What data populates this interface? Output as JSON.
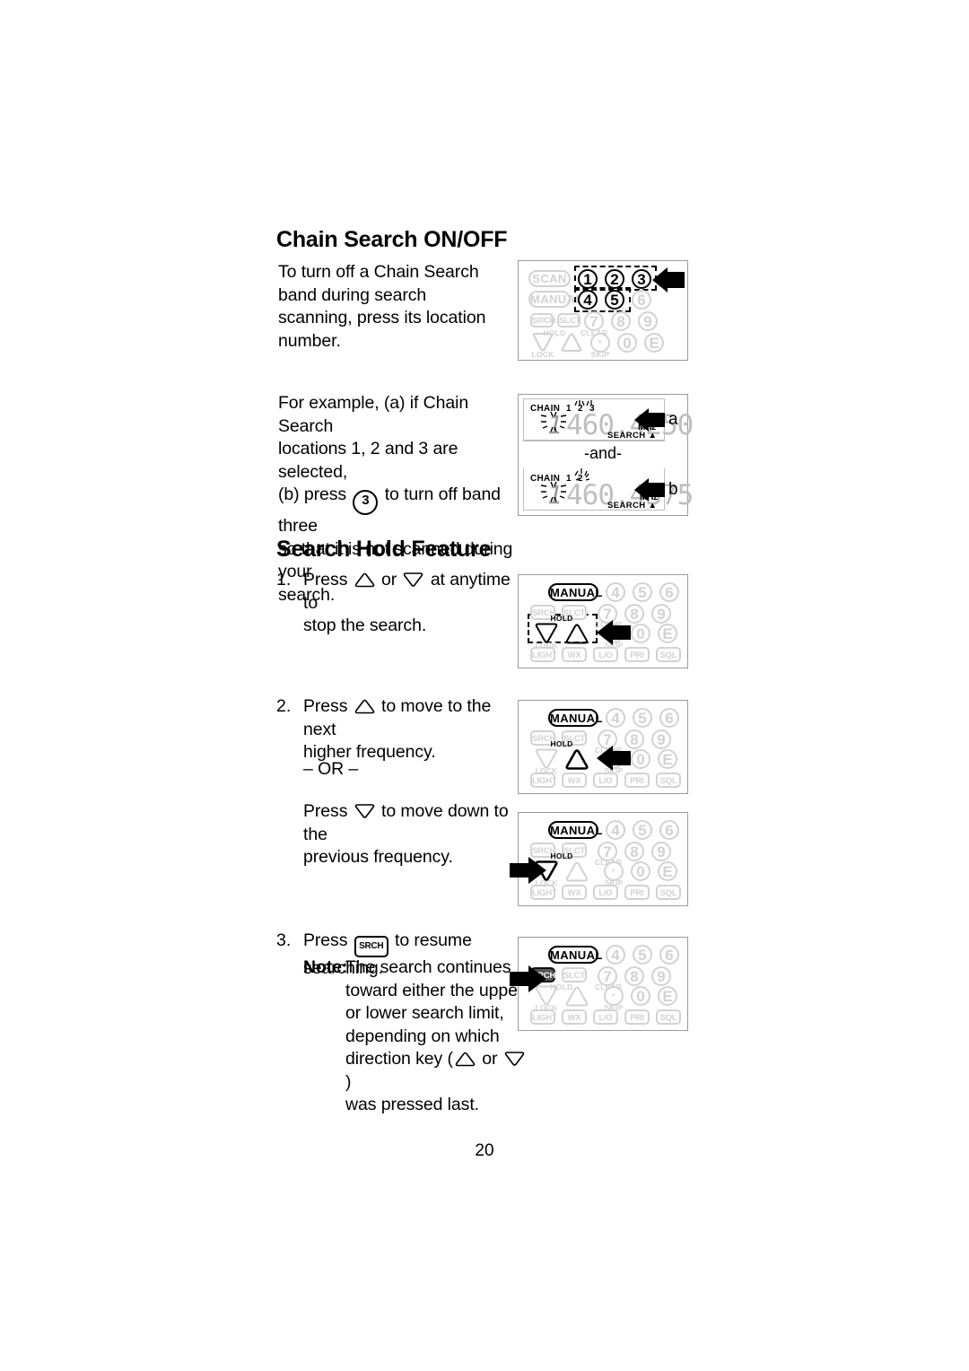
{
  "document": {
    "page_number": "20"
  },
  "sections": [
    {
      "heading": "Chain Search ON/OFF",
      "paragraph": "To turn off a Chain Search band during search scanning, press its location number."
    },
    {
      "heading": "Search Hold Feature"
    }
  ],
  "example": {
    "line1": "For example, (a) if Chain Search",
    "line2": "locations 1, 2 and 3 are selected,",
    "line3_pre": "(b) press",
    "line3_key": "3",
    "line3_post": "to turn off band three",
    "line4": "so that it is not scanned during your",
    "line5": "search."
  },
  "steps": [
    {
      "number": "1.",
      "pre": "Press",
      "mid": "or",
      "post": "at anytime to",
      "line2": "stop the search."
    },
    {
      "number": "2.",
      "pre": "Press",
      "post": "to move to the next",
      "line2": "higher frequency.",
      "or_divider": "– OR –",
      "alt_pre": "Press",
      "alt_post": "to move down to the",
      "alt_line2": "previous frequency."
    },
    {
      "number": "3.",
      "pre": "Press",
      "key": "SRCH",
      "post": "to resume searching.",
      "note_label": "Note:",
      "note_line1": "The search continues",
      "note_line2": "toward either the upper",
      "note_line3": "or lower search limit,",
      "note_line4": "depending on which",
      "note_line5_pre": "direction key (",
      "note_line5_mid": "or",
      "note_line5_post": ")",
      "note_line6": "was pressed last."
    }
  ],
  "keypad_labels": {
    "scan": "SCAN",
    "manual": "MANUAL",
    "srch": "SRCH",
    "slct": "SLCT",
    "hold": "HOLD",
    "clear": "CLEAR",
    "lock": "LOCK",
    "skip": "SKIP",
    "light": "LIGHT",
    "wx": "WX",
    "lo": "L/O",
    "pri": "PRI",
    "sql": "SQL",
    "dot": "·",
    "e": "E",
    "n1": "1",
    "n2": "2",
    "n3": "3",
    "n4": "4",
    "n5": "5",
    "n6": "6",
    "n7": "7",
    "n8": "8",
    "n9": "9",
    "n0": "0"
  },
  "lcd_a": {
    "chain_label": "CHAIN",
    "band1": "1",
    "band2": "2",
    "band3": "3",
    "digit1": "1",
    "frequency": "460.4250",
    "unit": "MHz",
    "search": "SEARCH ▲",
    "caption": "a"
  },
  "lcd_separator": "-and-",
  "lcd_b": {
    "chain_label": "CHAIN",
    "band1": "1",
    "band2": "2",
    "digit1": "1",
    "frequency": "460.4375",
    "unit": "MHz",
    "search": "SEARCH ▲",
    "caption": "b"
  },
  "colors": {
    "key_inactive": "#d2d2d2",
    "key_active": "#000000",
    "lcd_digit": "#bfbfbf",
    "box_border": "#9a9a9a"
  }
}
